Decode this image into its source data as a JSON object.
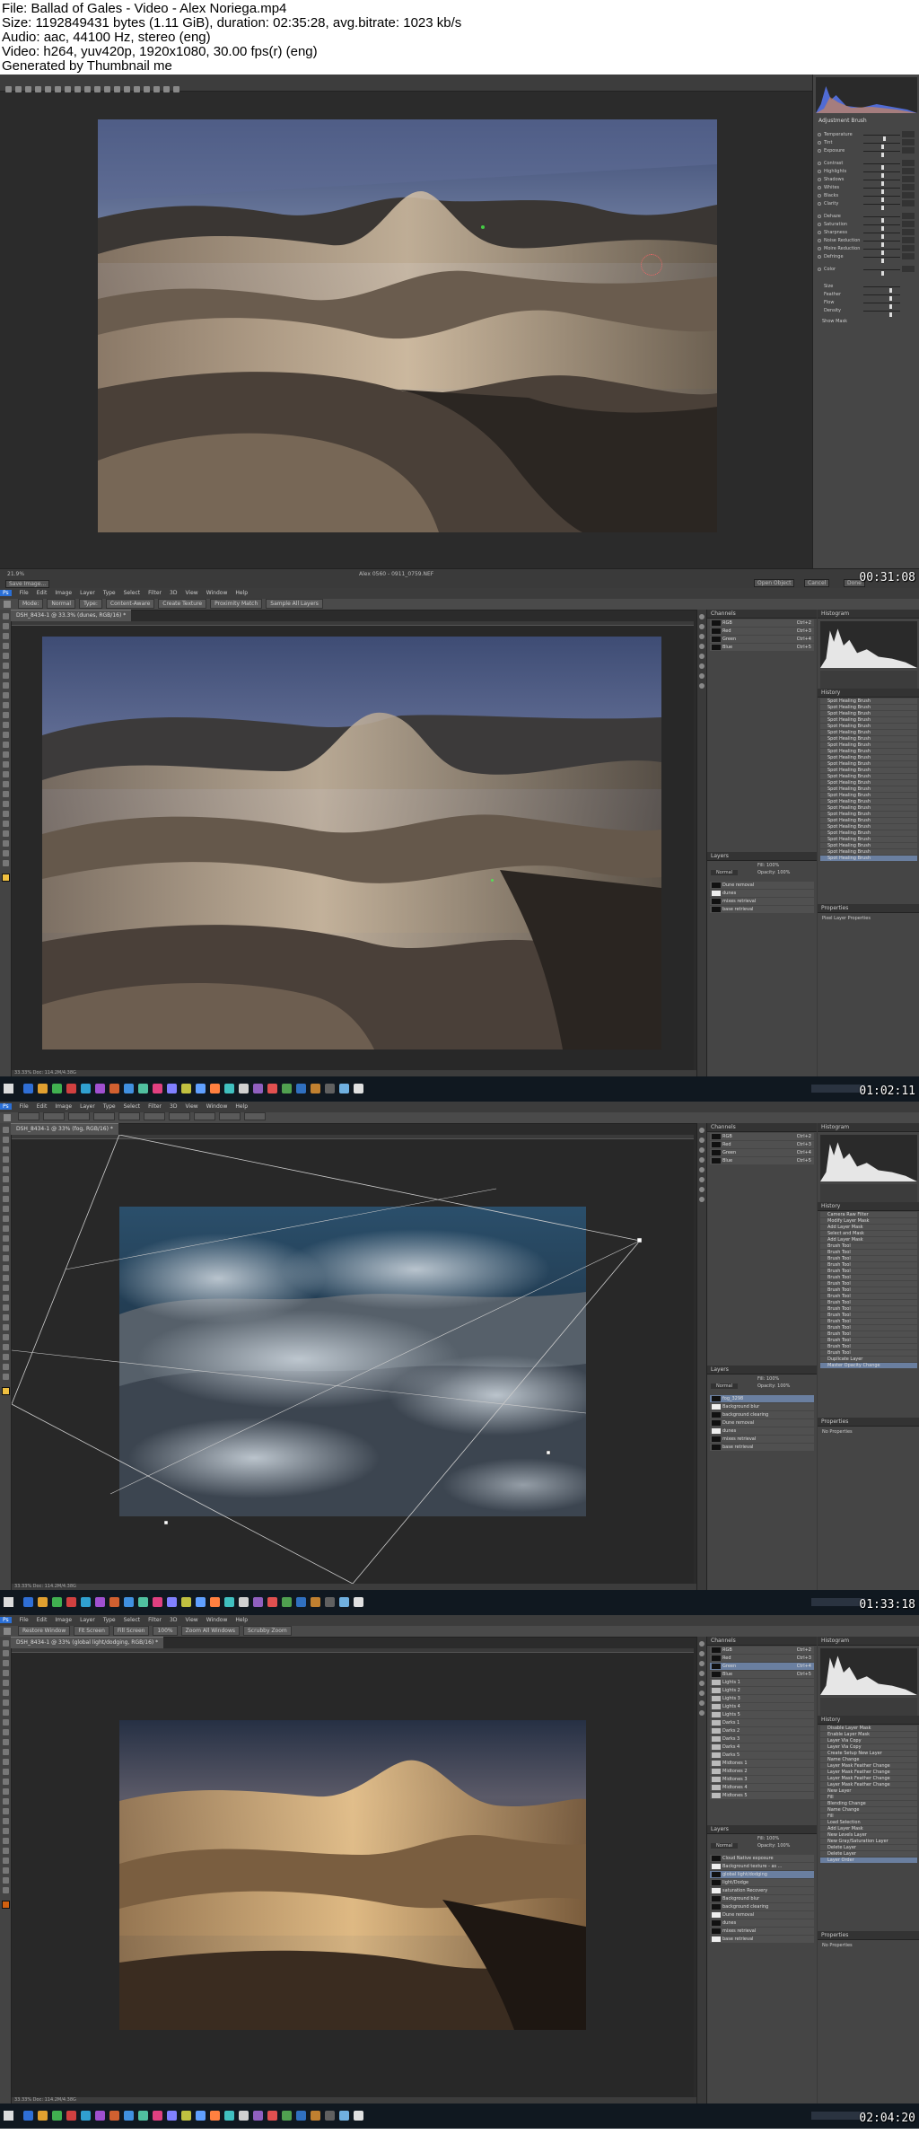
{
  "header": {
    "file": "File: Ballad of Gales - Video - Alex Noriega.mp4",
    "size": "Size: 1192849431 bytes (1.11 GiB), duration: 02:35:28, avg.bitrate: 1023 kb/s",
    "audio": "Audio: aac, 44100 Hz, stereo (eng)",
    "video": "Video: h264, yuv420p, 1920x1080, 30.00 fps(r) (eng)",
    "generator": "Generated by Thumbnail me"
  },
  "timestamps": [
    "00:31:08",
    "01:02:11",
    "01:33:18",
    "02:04:20"
  ],
  "acr": {
    "right_title": "Adjustment Brush",
    "sliders": [
      "Temperature",
      "Tint",
      "Exposure",
      "Contrast",
      "Highlights",
      "Shadows",
      "Whites",
      "Blacks",
      "Clarity",
      "Dehaze",
      "Saturation",
      "Sharpness",
      "Noise Reduction",
      "Moire Reduction",
      "Defringe",
      "Color"
    ],
    "knobs": [
      0.55,
      0.5,
      0.5,
      0.5,
      0.5,
      0.5,
      0.5,
      0.5,
      0.5,
      0.5,
      0.5,
      0.5,
      0.5,
      0.5,
      0.5,
      0.5
    ],
    "brush_labels": [
      "Size",
      "Feather",
      "Flow",
      "Density"
    ],
    "show_mask": "Show Mask",
    "save_button": "Save Image...",
    "zoom": "21.9%",
    "filename": "Alex 0560 - 0911_0759.NEF",
    "open_button": "Open Object",
    "cancel_button": "Cancel",
    "done_button": "Done"
  },
  "ps": {
    "menu": [
      "Ps",
      "File",
      "Edit",
      "Image",
      "Layer",
      "Type",
      "Select",
      "Filter",
      "3D",
      "View",
      "Window",
      "Help"
    ],
    "channels_title": "Channels",
    "channels": [
      {
        "name": "RGB",
        "key": "Ctrl+2"
      },
      {
        "name": "Red",
        "key": "Ctrl+3"
      },
      {
        "name": "Green",
        "key": "Ctrl+4"
      },
      {
        "name": "Blue",
        "key": "Ctrl+5"
      }
    ],
    "layers_title": "Layers",
    "histogram_title": "Histogram",
    "history_title": "History",
    "properties_title": "Properties",
    "blend_mode": "Normal",
    "opacity_label": "Opacity: 100%",
    "fill_label": "Fill: 100%"
  },
  "frame1": {
    "tab": "DSH_8434-1 @ 33.3% (dunes, RGB/16) *",
    "options": [
      "Mode:",
      "Normal",
      "Type:",
      "Content-Aware",
      "Create Texture",
      "Proximity Match",
      "Sample All Layers"
    ],
    "layers": [
      "Dune removal",
      "dunes",
      "mixes retrieval",
      "base retrieval"
    ],
    "history_item": "Spot Healing Brush",
    "history_count": 26,
    "properties_sub": "Pixel Layer Properties",
    "status": "33.33%    Doc: 114.2M/4.38G"
  },
  "frame2": {
    "tab": "DSH_8434-1 @ 33% (fog, RGB/16) *",
    "layers": [
      "fog_3298",
      "Background blur",
      "background clearing",
      "Dune removal",
      "dunes",
      "mixes retrieval",
      "base retrieval"
    ],
    "history_items": [
      "Camera Raw Filter",
      "Modify Layer Mask",
      "Add Layer Mask",
      "Select and Mask",
      "Add Layer Mask",
      "Brush Tool",
      "Brush Tool",
      "Brush Tool",
      "Brush Tool",
      "Brush Tool",
      "Brush Tool",
      "Brush Tool",
      "Brush Tool",
      "Brush Tool",
      "Brush Tool",
      "Brush Tool",
      "Brush Tool",
      "Brush Tool",
      "Brush Tool",
      "Brush Tool",
      "Brush Tool",
      "Brush Tool",
      "Brush Tool",
      "Duplicate Layer",
      "Master Opacity Change"
    ],
    "properties_empty": "No Properties",
    "status": "33.33%    Doc: 114.2M/4.38G"
  },
  "frame3": {
    "tab": "DSH_8434-1 @ 33% (global light/dodging, RGB/16) *",
    "options": [
      "Restore Window",
      "Fit Screen",
      "Fill Screen",
      "100%",
      "Zoom All Windows",
      "Scrubby Zoom"
    ],
    "channels_extra": [
      "Lights 1",
      "Lights 2",
      "Lights 3",
      "Lights 4",
      "Lights 5",
      "Darks 1",
      "Darks 2",
      "Darks 3",
      "Darks 4",
      "Darks 5",
      "Midtones 1",
      "Midtones 2",
      "Midtones 3",
      "Midtones 4",
      "Midtones 5"
    ],
    "layers": [
      "Cloud Native exposure",
      "Background texture - as ...",
      "global light/dodging",
      "light/Dodge",
      "saturation Recovery",
      "Background blur",
      "background clearing",
      "Dune removal",
      "dunes",
      "mixes retrieval",
      "base retrieval"
    ],
    "history_items": [
      "Disable Layer Mask",
      "Enable Layer Mask",
      "Layer Via Copy",
      "Layer Via Copy",
      "Create Setup New Layer",
      "Name Change",
      "Layer Mask Feather Change",
      "Layer Mask Feather Change",
      "Layer Mask Feather Change",
      "Layer Mask Feather Change",
      "New Layer",
      "Fill",
      "Blending Change",
      "Name Change",
      "Fill",
      "Load Selection",
      "Add Layer Mask",
      "New Levels Layer",
      "New Gray/Saturation Layer",
      "Delete Layer",
      "Delete Layer",
      "Layer Order"
    ],
    "properties_empty": "No Properties",
    "status": "33.33%    Doc: 114.2M/4.38G"
  }
}
